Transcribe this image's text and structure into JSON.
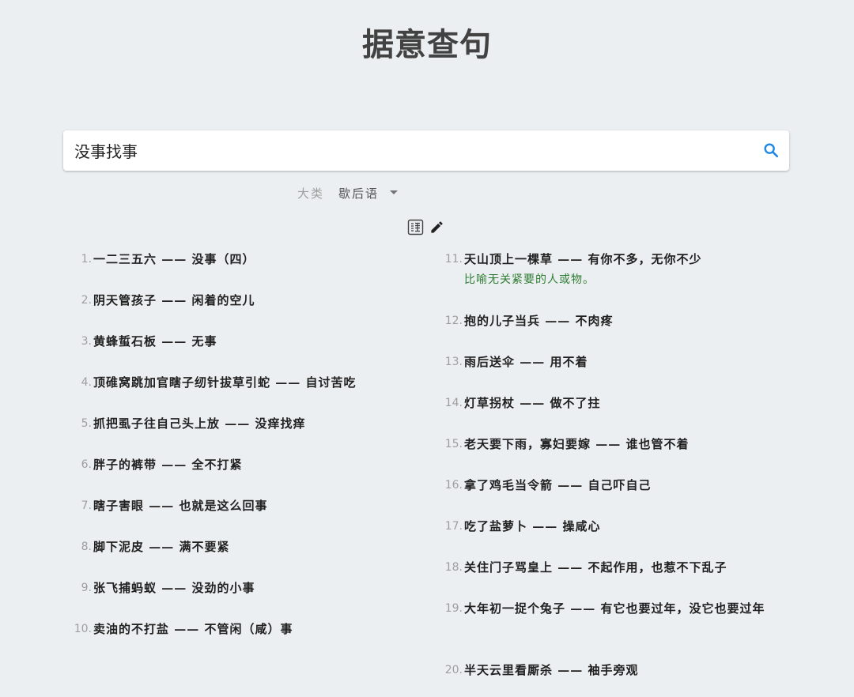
{
  "page": {
    "title": "据意查句"
  },
  "search": {
    "value": "没事找事"
  },
  "filter": {
    "label": "大类",
    "selected": "歇后语"
  },
  "results": [
    {
      "num": "1.",
      "text": "一二三五六 —— 没事（四）"
    },
    {
      "num": "2.",
      "text": "阴天管孩子 —— 闲着的空儿"
    },
    {
      "num": "3.",
      "text": "黄蜂蜇石板 —— 无事"
    },
    {
      "num": "4.",
      "text": "顶碓窝跳加官瞎子纫针拔草引蛇 —— 自讨苦吃"
    },
    {
      "num": "5.",
      "text": "抓把虱子往自己头上放 —— 没痒找痒"
    },
    {
      "num": "6.",
      "text": "胖子的裤带 —— 全不打紧"
    },
    {
      "num": "7.",
      "text": "瞎子害眼 —— 也就是这么回事"
    },
    {
      "num": "8.",
      "text": "脚下泥皮 —— 满不要紧"
    },
    {
      "num": "9.",
      "text": "张飞捕蚂蚁 —— 没劲的小事"
    },
    {
      "num": "10.",
      "text": "卖油的不打盐 —— 不管闲（咸）事"
    },
    {
      "num": "11.",
      "text": "天山顶上一棵草 —— 有你不多，无你不少",
      "explain": "比喻无关紧要的人或物。"
    },
    {
      "num": "12.",
      "text": "抱的儿子当兵 —— 不肉疼"
    },
    {
      "num": "13.",
      "text": "雨后送伞 —— 用不着"
    },
    {
      "num": "14.",
      "text": "灯草拐杖 —— 做不了拄"
    },
    {
      "num": "15.",
      "text": "老天要下雨，寡妇要嫁 —— 谁也管不着"
    },
    {
      "num": "16.",
      "text": "拿了鸡毛当令箭 —— 自己吓自己"
    },
    {
      "num": "17.",
      "text": "吃了盐萝卜 —— 操咸心"
    },
    {
      "num": "18.",
      "text": "关住门子骂皇上 —— 不起作用，也惹不下乱子"
    },
    {
      "num": "19.",
      "text": "大年初一捉个兔子 —— 有它也要过年，没它也要过年"
    },
    {
      "num": "20.",
      "text": "半天云里看厮杀 —— 袖手旁观"
    }
  ],
  "colors": {
    "background": "#eceff1",
    "accent": "#1e88e5",
    "explain": "#2e7d32"
  },
  "icons": {
    "search": "search-icon",
    "dropdown": "chevron-down-icon",
    "translate": "translate-icon",
    "edit": "edit-icon"
  }
}
